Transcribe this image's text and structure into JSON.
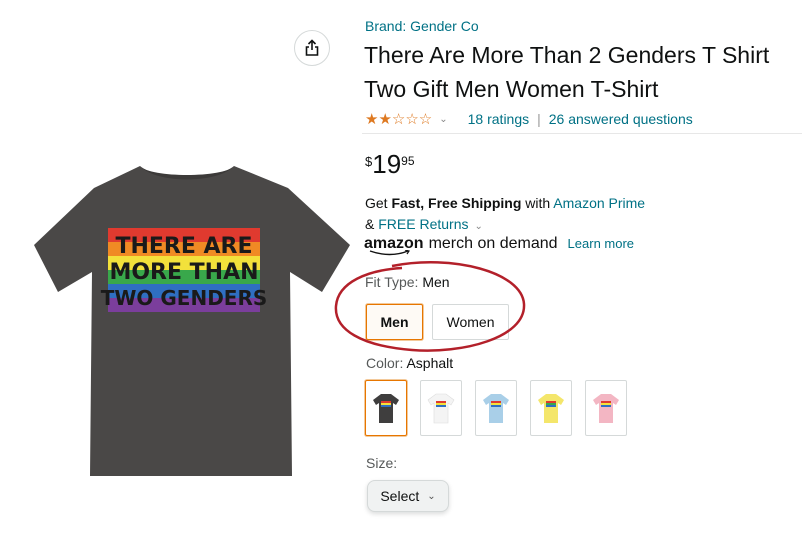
{
  "product": {
    "brand": "Brand: Gender Co",
    "title": "There Are More Than 2 Genders T Shirt Two Gift Men Women T-Shirt",
    "rating_stars": 2.5,
    "ratings_count": "18 ratings",
    "answered_questions": "26 answered questions",
    "price": {
      "symbol": "$",
      "whole": "19",
      "fraction": "95"
    },
    "shirt_print": [
      "THERE ARE",
      "MORE THAN",
      "TWO GENDERS"
    ]
  },
  "shipping": {
    "line1_prefix": "Get ",
    "line1_bold": "Fast, Free Shipping",
    "line1_mid": " with ",
    "line1_link": "Amazon Prime",
    "line2_prefix": "& ",
    "line2_link": "FREE Returns"
  },
  "merch": {
    "amazon": "amazon",
    "rest": "merch on demand",
    "learn_more": "Learn more"
  },
  "fit": {
    "label": "Fit Type: ",
    "selected": "Men",
    "options": [
      "Men",
      "Women"
    ]
  },
  "color": {
    "label": "Color: ",
    "selected": "Asphalt",
    "swatches": [
      {
        "name": "Asphalt",
        "hex": "#3f3e3e"
      },
      {
        "name": "White",
        "hex": "#f4f4f4"
      },
      {
        "name": "Light Blue",
        "hex": "#a9cfe8"
      },
      {
        "name": "Yellow",
        "hex": "#f4e66b"
      },
      {
        "name": "Pink",
        "hex": "#f3b6c3"
      }
    ]
  },
  "size": {
    "label": "Size:",
    "select_label": "Select"
  },
  "icons": {
    "share": "share-icon",
    "chevron": "chevron-down-icon"
  },
  "colors": {
    "link": "#007185",
    "star": "#de7921",
    "selection": "#e77600",
    "annotation": "#b3202a",
    "shirt": "#4a4847"
  }
}
